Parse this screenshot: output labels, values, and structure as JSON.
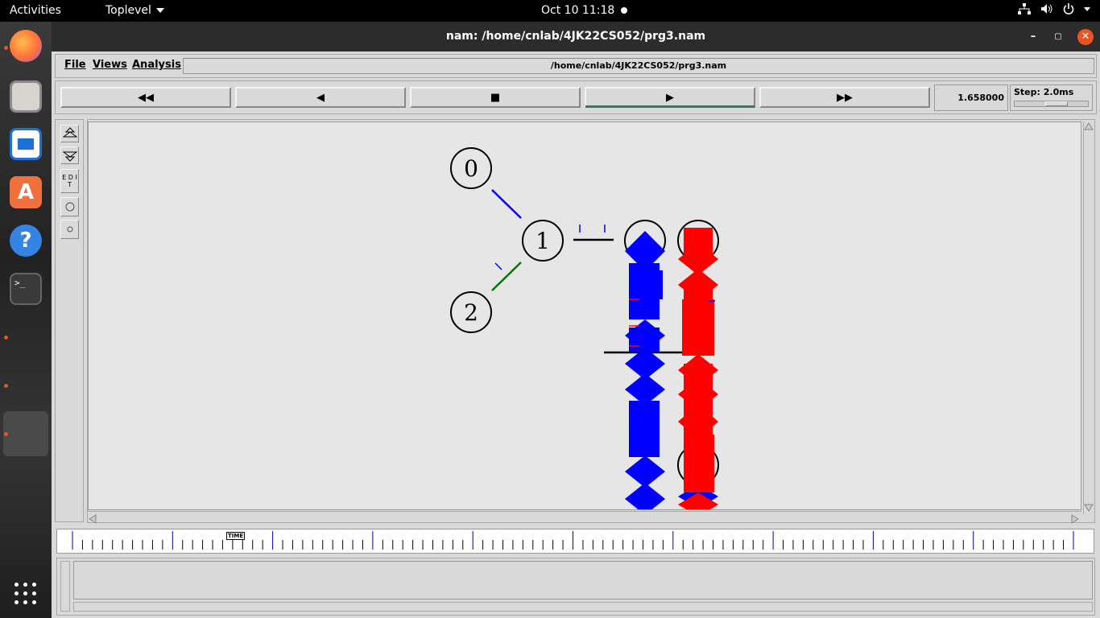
{
  "topbar": {
    "activities": "Activities",
    "app_menu": "Toplevel",
    "clock": "Oct 10  11:18"
  },
  "window": {
    "title": "nam: /home/cnlab/4JK22CS052/prg3.nam",
    "buttons": {
      "minimize": "–",
      "maximize": "▢",
      "close": "✕"
    }
  },
  "menu": {
    "file": "File",
    "views": "Views",
    "analysis": "Analysis",
    "path": "/home/cnlab/4JK22CS052/prg3.nam"
  },
  "controls": {
    "rewind": "◀◀",
    "back": "◀",
    "stop": "■",
    "play": "▶",
    "fast_forward": "▶▶",
    "time": "1.658000",
    "step": "Step: 2.0ms"
  },
  "tools": {
    "edit": "E D I T"
  },
  "nodes": [
    "0",
    "1",
    "2",
    "",
    "",
    ""
  ],
  "timeline": {
    "label": "TIME"
  },
  "colors": {
    "flow_blue": "#0000ff",
    "flow_red": "#ff0000",
    "link_green": "#007700",
    "close_button": "#e95420",
    "play_active": "#2e7d5a"
  },
  "dock": [
    "firefox-icon",
    "files-icon",
    "writer-icon",
    "software-icon",
    "help-icon",
    "terminal-icon",
    "apps-grid-icon"
  ]
}
